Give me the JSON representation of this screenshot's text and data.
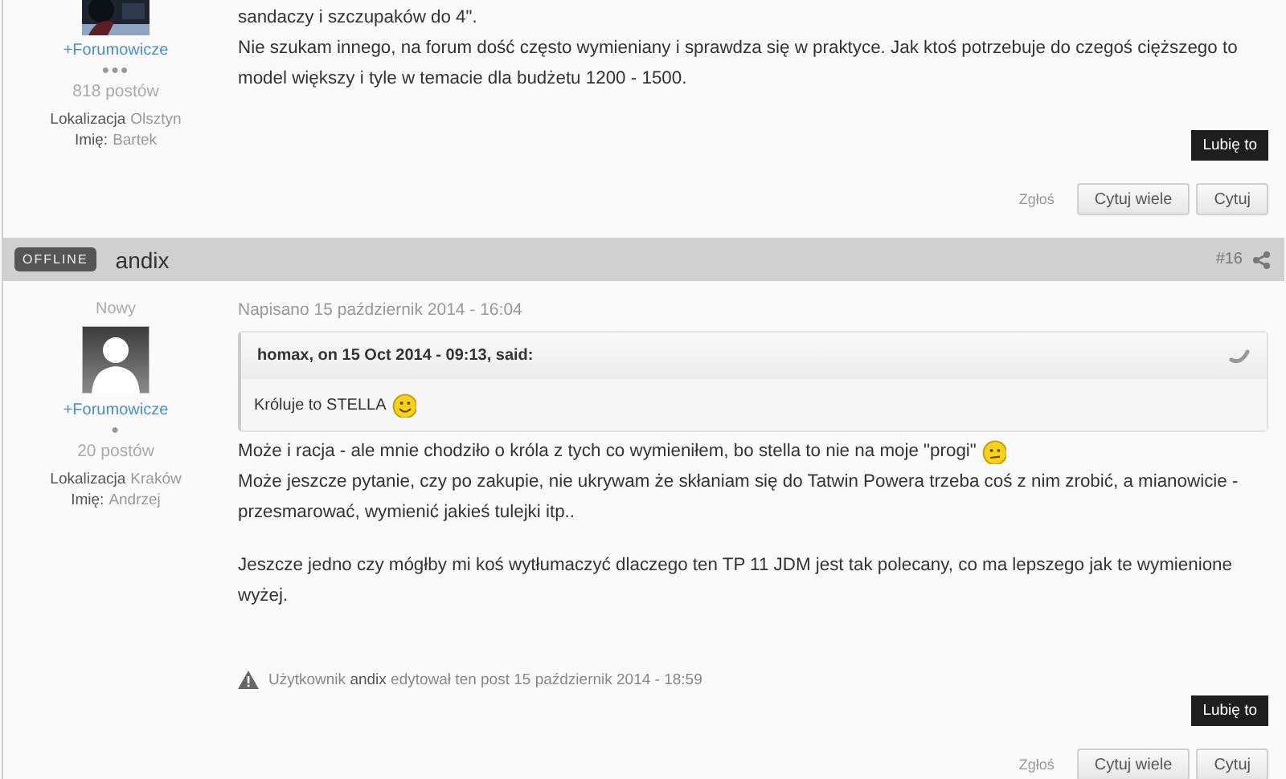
{
  "posts": [
    {
      "author": {
        "group": "+Forumowicze",
        "rank_pips": "●●●",
        "post_count": "818 postów",
        "location_label": "Lokalizacja",
        "location": "Olsztyn",
        "name_label": "Imię:",
        "name": "Bartek"
      },
      "lines": [
        {
          "text": "sandaczy i szczupaków do 4\"."
        },
        {
          "text": "Nie szukam innego, na forum dość często wymieniany i sprawdza się w praktyce. Jak ktoś potrzebuje do czegoś cięższego to"
        },
        {
          "text": "model większy i tyle w temacie dla budżetu 1200 - 1500."
        }
      ],
      "like_button": "Lubię to",
      "report": "Zgłoś",
      "buttons": [
        "Cytuj wiele",
        "Cytuj"
      ]
    },
    {
      "header": {
        "status": "OFFLINE",
        "username": "andix",
        "number": "#16"
      },
      "author": {
        "rank_title": "Nowy",
        "avatar": {
          "kind": "silhouette"
        },
        "group": "+Forumowicze",
        "rank_pips": "●",
        "post_count": "20 postów",
        "location_label": "Lokalizacja",
        "location": "Kraków",
        "name_label": "Imię:",
        "name": "Andrzej"
      },
      "date": "Napisano 15 październik 2014 - 16:04",
      "quote": {
        "citation": "homax, on 15 Oct 2014 - 09:13, said:",
        "text": "Króluje to STELLA",
        "emoticon": {
          "kind": "smile"
        }
      },
      "lines": [
        {
          "text": "Może i racja - ale mnie chodziło o króla z tych co wymieniłem, bo stella to nie na moje \"progi\"",
          "emoticon": {
            "kind": "unsure"
          }
        },
        {
          "text": "Może jeszcze pytanie, czy po zakupie, nie ukrywam że skłaniam się do Tatwin Powera trzeba coś z nim zrobić, a mianowicie -"
        },
        {
          "text": "przesmarować, wymienić jakieś tulejki itp.."
        },
        {
          "kind": "blank"
        },
        {
          "text": "Jeszcze jedno czy mógłby mi koś wytłumaczyć dlaczego ten TP 11 JDM jest tak polecany, co ma lepszego jak te wymienione"
        },
        {
          "text": "wyżej."
        }
      ],
      "edit_note": "Użytkownik **andix** edytował ten post 15 październik 2014 - 18:59",
      "like_button": "Lubię to",
      "report": "Zgłoś",
      "buttons": [
        "Cytuj wiele",
        "Cytuj"
      ]
    }
  ]
}
